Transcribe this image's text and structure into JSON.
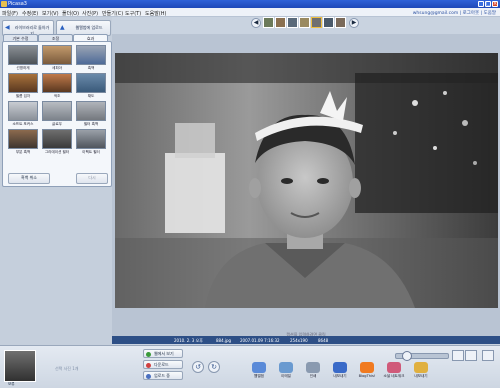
{
  "window": {
    "title": "Picasa3"
  },
  "menu": [
    "파일(F)",
    "수정(E)",
    "보기(V)",
    "폴더(O)",
    "사진(P)",
    "만들기(C)",
    "도구(T)",
    "도움말(H)"
  ],
  "account": {
    "email": "whsung@gmail.com",
    "sign_out": "로그아웃",
    "help": "도움말"
  },
  "left": {
    "back_button": "라이브러리로 돌아가기",
    "upload_button": "웹앨범에 업로드",
    "tabs": [
      "기본 수정",
      "조정",
      "효과"
    ],
    "effects": [
      "선명하게",
      "세피아",
      "흑백",
      "필름 입자",
      "색조",
      "채도",
      "소프트 포커스",
      "글로우",
      "필터 흑백",
      "부분 흑백",
      "그라데이션 필터",
      "이펙트 필터"
    ],
    "undo_button": "흑백 취소",
    "redo_button": "다시"
  },
  "caption": "캡션을 입력하려면 클릭",
  "info": {
    "date": "2010. 2. 3 오후",
    "file": "884.jpg",
    "dims": "2007.01.09 7:16:32",
    "size": "254x190",
    "zoom": "8648"
  },
  "tray": {
    "hold": "보류",
    "selection_label": "선택 사진 1개",
    "buttons": [
      "웹에서 보기",
      "다운로드",
      "업로드 중"
    ],
    "actions": [
      "웹앨범",
      "이메일",
      "인쇄",
      "내보내기",
      "BlogThis!",
      "소셜 네트워크",
      "내보내기"
    ]
  },
  "colors": {
    "accent": "#2d4f86",
    "titlebar": "#2f62d8"
  }
}
